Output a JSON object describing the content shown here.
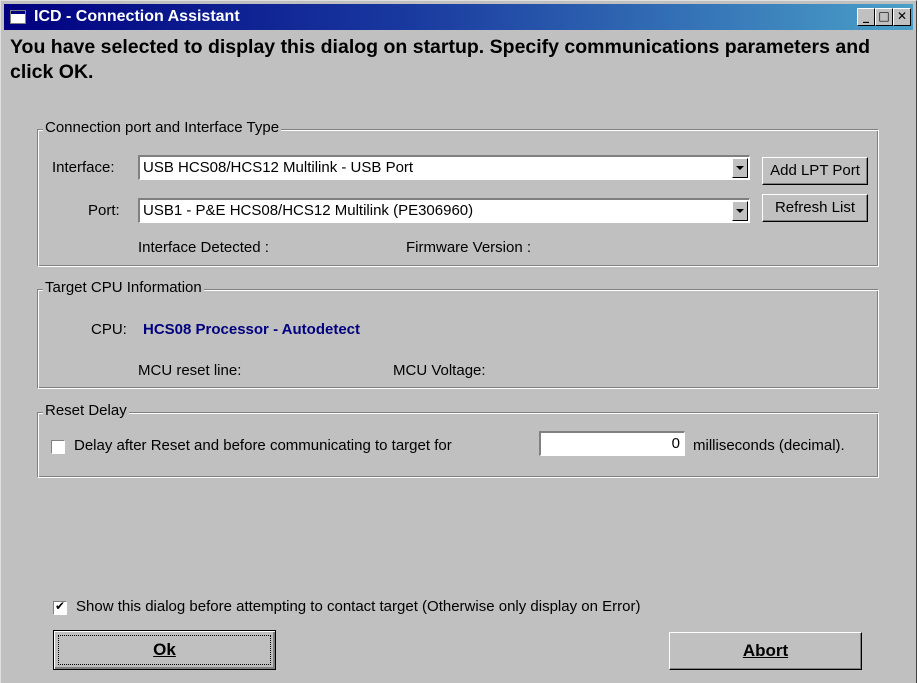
{
  "window": {
    "title": "ICD - Connection Assistant",
    "controls": {
      "minimize": "_",
      "maximize": "□",
      "close": "✕"
    }
  },
  "heading": "You have selected to display this dialog on startup. Specify communications parameters and click OK.",
  "connection": {
    "legend": "Connection port and Interface Type",
    "interface_label": "Interface:",
    "interface_value": "USB HCS08/HCS12 Multilink - USB Port",
    "port_label": "Port:",
    "port_value": "USB1 - P&E HCS08/HCS12 Multilink (PE306960)",
    "add_lpt_label": "Add LPT Port",
    "refresh_label": "Refresh List",
    "interface_detected": "Interface Detected :",
    "firmware_version": "Firmware Version :"
  },
  "target": {
    "legend": "Target CPU Information",
    "cpu_label": "CPU:",
    "cpu_value": "HCS08 Processor - Autodetect",
    "cpu_value_color": "#000080",
    "reset_line": "MCU reset line:",
    "voltage": "MCU Voltage:"
  },
  "reset": {
    "legend": "Reset Delay",
    "checkbox_label": "Delay after Reset and before communicating to target for",
    "checked": false,
    "delay_value": "0",
    "units": "milliseconds (decimal)."
  },
  "show_dialog": {
    "label": "Show this dialog before attempting to contact target (Otherwise only display on Error)",
    "checked": true
  },
  "buttons": {
    "ok": "Ok",
    "abort": "Abort"
  }
}
